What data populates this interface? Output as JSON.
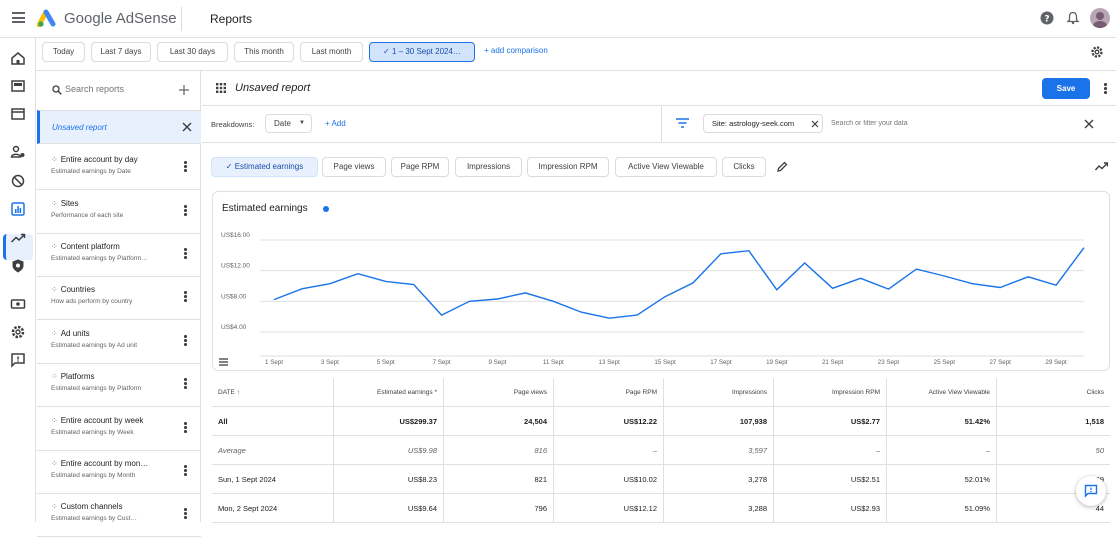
{
  "header": {
    "brand": "Google AdSense",
    "page_title": "Reports"
  },
  "date_chips": [
    {
      "label": "Today"
    },
    {
      "label": "Last 7 days"
    },
    {
      "label": "Last 30 days"
    },
    {
      "label": "This month"
    },
    {
      "label": "Last month"
    },
    {
      "label": "1 – 30 Sept 2024…",
      "selected": true
    }
  ],
  "add_comparison": "+ add comparison",
  "sidebar": {
    "search_placeholder": "Search reports",
    "unsaved": "Unsaved report",
    "items": [
      {
        "title": "Entire account by day",
        "subtitle": "Estimated earnings by Date"
      },
      {
        "title": "Sites",
        "subtitle": "Performance of each site"
      },
      {
        "title": "Content platform",
        "subtitle": "Estimated earnings by Platform…"
      },
      {
        "title": "Countries",
        "subtitle": "How ads perform by country"
      },
      {
        "title": "Ad units",
        "subtitle": "Estimated earnings by Ad unit"
      },
      {
        "title": "Platforms",
        "subtitle": "Estimated earnings by Platform"
      },
      {
        "title": "Entire account by week",
        "subtitle": "Estimated earnings by Week"
      },
      {
        "title": "Entire account by mon…",
        "subtitle": "Estimated earnings by Month"
      },
      {
        "title": "Custom channels",
        "subtitle": "Estimated earnings by Cust…"
      }
    ]
  },
  "report": {
    "name": "Unsaved report",
    "save_label": "Save",
    "breakdowns_label": "Breakdowns:",
    "breakdown_value": "Date",
    "add_label": "Add",
    "filter_chip": "Site: astrology-seek.com",
    "filter_placeholder": "Search or filter your data"
  },
  "metrics": [
    {
      "label": "Estimated earnings",
      "selected": true
    },
    {
      "label": "Page views"
    },
    {
      "label": "Page RPM"
    },
    {
      "label": "Impressions"
    },
    {
      "label": "Impression RPM"
    },
    {
      "label": "Active View Viewable"
    },
    {
      "label": "Clicks"
    }
  ],
  "chart_data": {
    "type": "line",
    "title": "Estimated earnings",
    "series_color": "#1a73e8",
    "y_ticks": [
      "US$16.00",
      "US$12.00",
      "US$8.00",
      "US$4.00"
    ],
    "ylim": [
      4,
      16
    ],
    "x_tick_labels": [
      "1 Sept",
      "3 Sept",
      "5 Sept",
      "7 Sept",
      "9 Sept",
      "11 Sept",
      "13 Sept",
      "15 Sept",
      "17 Sept",
      "19 Sept",
      "21 Sept",
      "23 Sept",
      "25 Sept",
      "27 Sept",
      "29 Sept"
    ],
    "x": [
      1,
      2,
      3,
      4,
      5,
      6,
      7,
      8,
      9,
      10,
      11,
      12,
      13,
      14,
      15,
      16,
      17,
      18,
      19,
      20,
      21,
      22,
      23,
      24,
      25,
      26,
      27,
      28,
      29,
      30
    ],
    "values": [
      8.23,
      9.64,
      10.3,
      11.6,
      10.6,
      10.2,
      6.2,
      8.0,
      8.3,
      9.1,
      8.0,
      6.6,
      5.8,
      6.2,
      8.6,
      10.4,
      14.2,
      14.6,
      9.5,
      13.0,
      9.7,
      11.0,
      9.6,
      12.2,
      11.3,
      10.3,
      9.8,
      11.2,
      10.1,
      15.0
    ]
  },
  "table": {
    "headers": [
      "DATE ↑",
      "Estimated earnings *",
      "Page views",
      "Page RPM",
      "Impressions",
      "Impression RPM",
      "Active View Viewable",
      "Clicks"
    ],
    "rows": [
      {
        "kind": "total",
        "cells": [
          "All",
          "US$299.37",
          "24,504",
          "US$12.22",
          "107,938",
          "US$2.77",
          "51.42%",
          "1,518"
        ]
      },
      {
        "kind": "avg",
        "cells": [
          "Average",
          "US$9.98",
          "816",
          "–",
          "3,597",
          "–",
          "–",
          "50"
        ]
      },
      {
        "kind": "row",
        "cells": [
          "Sun, 1 Sept 2024",
          "US$8.23",
          "821",
          "US$10.02",
          "3,278",
          "US$2.51",
          "52.01%",
          "39"
        ]
      },
      {
        "kind": "row",
        "cells": [
          "Mon, 2 Sept 2024",
          "US$9.64",
          "796",
          "US$12.12",
          "3,288",
          "US$2.93",
          "51.09%",
          "44"
        ]
      }
    ]
  }
}
